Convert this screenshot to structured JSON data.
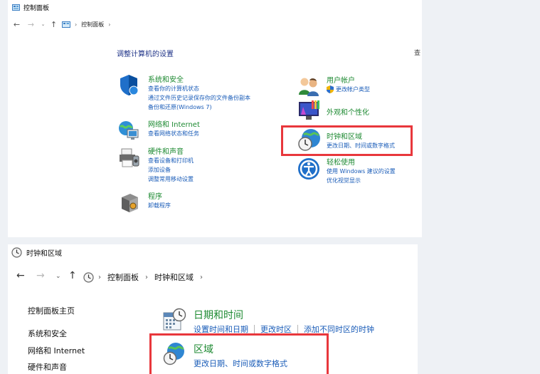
{
  "top_window": {
    "title": "控制面板",
    "breadcrumb": "控制面板",
    "heading": "调整计算机的设置",
    "view_by": "查",
    "categories": {
      "system": {
        "title": "系统和安全",
        "links": [
          "查看你的计算机状态",
          "通过文件历史记录保存你的文件备份副本",
          "备份和还原(Windows 7)"
        ]
      },
      "network": {
        "title": "网络和 Internet",
        "links": [
          "查看网络状态和任务"
        ]
      },
      "hardware": {
        "title": "硬件和声音",
        "links": [
          "查看设备和打印机",
          "添加设备",
          "调整常用移动设置"
        ]
      },
      "programs": {
        "title": "程序",
        "links": [
          "卸载程序"
        ]
      },
      "users": {
        "title": "用户帐户",
        "links": [
          "更改帐户类型"
        ]
      },
      "appearance": {
        "title": "外观和个性化",
        "links": []
      },
      "clock": {
        "title": "时钟和区域",
        "links": [
          "更改日期、时间或数字格式"
        ]
      },
      "ease": {
        "title": "轻松使用",
        "links": [
          "使用 Windows 建议的设置",
          "优化视觉显示"
        ]
      }
    }
  },
  "bottom_window": {
    "title": "时钟和区域",
    "breadcrumb": [
      "控制面板",
      "时钟和区域"
    ],
    "sidebar": [
      "控制面板主页",
      "系统和安全",
      "网络和 Internet",
      "硬件和声音"
    ],
    "sections": {
      "datetime": {
        "title": "日期和时间",
        "links": [
          "设置时间和日期",
          "更改时区",
          "添加不同时区的时钟"
        ]
      },
      "region": {
        "title": "区域",
        "links": [
          "更改日期、时间或数字格式"
        ]
      }
    }
  },
  "colors": {
    "highlight_box": "#e8373c",
    "category_title": "#1e8a32",
    "link": "#1a5cb8",
    "heading": "#1e3287"
  }
}
